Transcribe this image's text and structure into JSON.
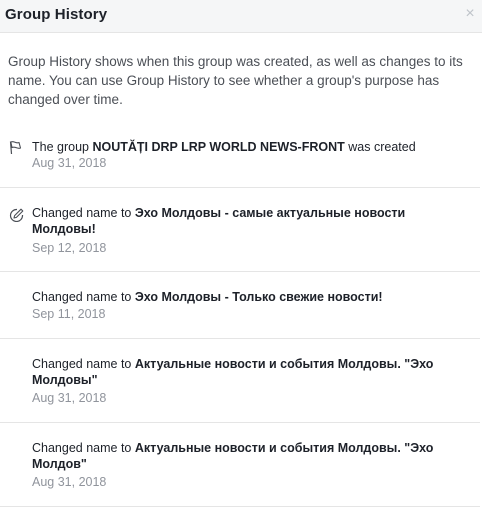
{
  "dialog": {
    "title": "Group History",
    "close_icon": "close-icon",
    "intro": "Group History shows when this group was created, as well as changes to its name. You can use Group History to see whether a group's purpose has changed over time."
  },
  "entries": [
    {
      "icon": "flag-icon",
      "prefix": "The group ",
      "name": "NOUTĂȚI DRP LRP WORLD NEWS-FRONT",
      "suffix": " was created",
      "date": "Aug 31, 2018"
    },
    {
      "icon": "pencil-icon",
      "prefix": "Changed name to ",
      "name": "Эхо Молдовы - самые актуальные новости Молдовы!",
      "suffix": "",
      "date": "Sep 12, 2018"
    },
    {
      "icon": "",
      "prefix": "Changed name to ",
      "name": "Эхо Молдовы - Только свежие новости!",
      "suffix": "",
      "date": "Sep 11, 2018"
    },
    {
      "icon": "",
      "prefix": "Changed name to ",
      "name": "Актуальные новости и события Молдовы. \"Эхо Молдовы\"",
      "suffix": "",
      "date": "Aug 31, 2018"
    },
    {
      "icon": "",
      "prefix": "Changed name to ",
      "name": "Актуальные новости и события Молдовы. \"Эхо Молдов\"",
      "suffix": "",
      "date": "Aug 31, 2018"
    }
  ]
}
